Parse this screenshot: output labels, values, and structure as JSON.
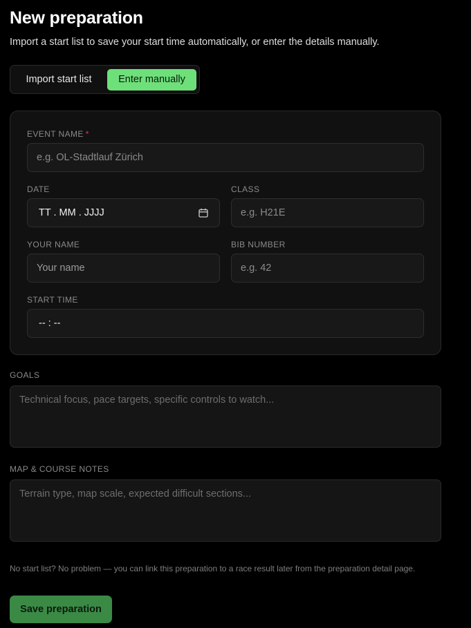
{
  "header": {
    "title": "New preparation",
    "subtitle": "Import a start list to save your start time automatically, or enter the details manually."
  },
  "mode_toggle": {
    "options": [
      {
        "label": "Import start list",
        "selected": false
      },
      {
        "label": "Enter manually",
        "selected": true
      }
    ],
    "accent_color": "#6ee07a"
  },
  "form": {
    "event_name": {
      "label": "EVENT NAME",
      "required_marker": "*",
      "placeholder": "e.g. OL-Stadtlauf Zürich"
    },
    "date": {
      "label": "DATE",
      "value": "TT . MM . JJJJ",
      "icon": "calendar-icon"
    },
    "class": {
      "label": "CLASS",
      "placeholder": "e.g. H21E"
    },
    "your_name": {
      "label": "YOUR NAME",
      "placeholder": "Your name"
    },
    "bib_number": {
      "label": "BIB NUMBER",
      "placeholder": "e.g. 42"
    },
    "start_time": {
      "label": "START TIME",
      "value": "-- : --"
    },
    "goals": {
      "label": "GOALS",
      "placeholder": "Technical focus, pace targets, specific controls to watch..."
    },
    "notes": {
      "label": "MAP & COURSE NOTES",
      "placeholder": "Terrain type, map scale, expected difficult sections..."
    }
  },
  "footer": {
    "hint": "No start list? No problem — you can link this preparation to a race result later from the preparation detail page.",
    "save_label": "Save preparation",
    "save_color": "#3a8a45"
  }
}
